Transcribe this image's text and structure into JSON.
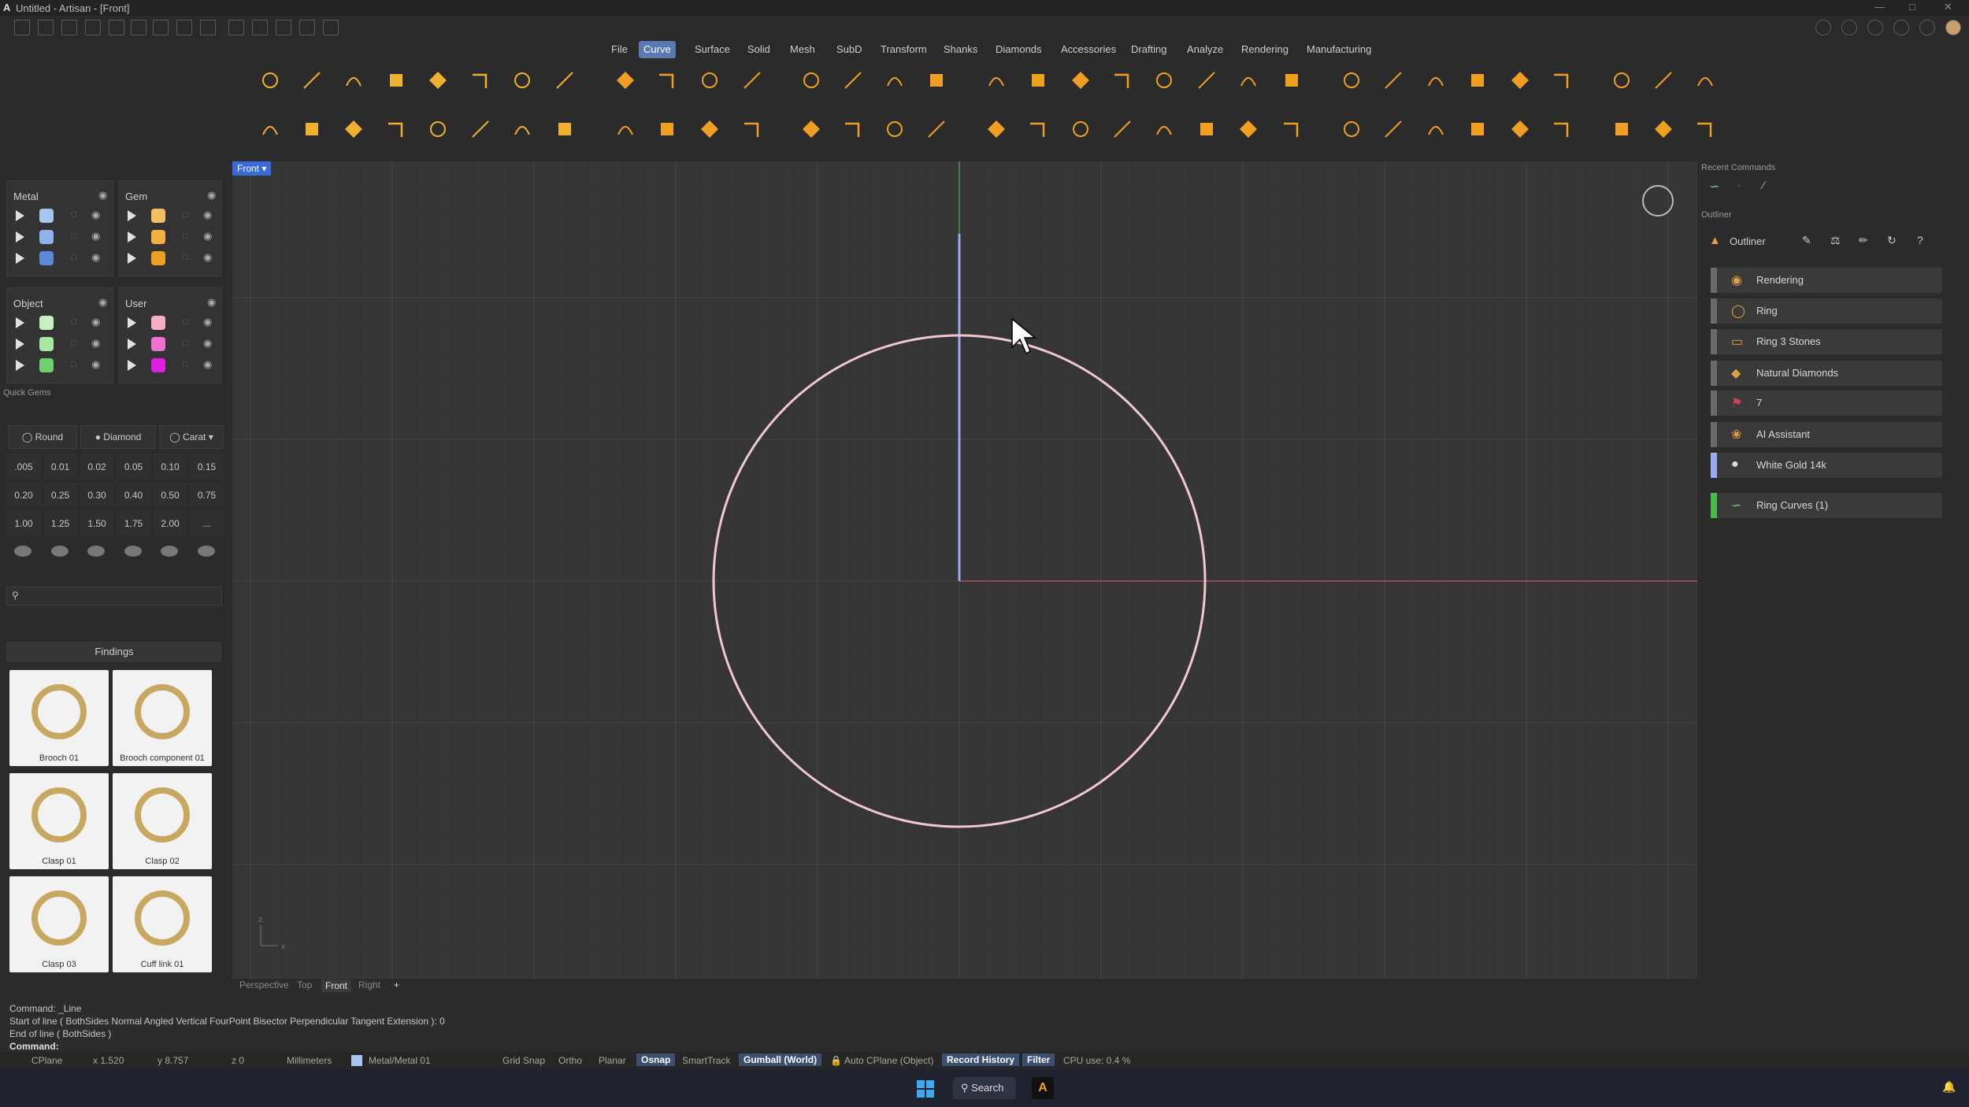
{
  "window": {
    "title": "Untitled - Artisan - [Front]"
  },
  "menu": {
    "tabs": [
      "File",
      "Curve",
      "Surface",
      "Solid",
      "Mesh",
      "SubD",
      "Transform",
      "Shanks",
      "Diamonds",
      "Accessories",
      "Drafting",
      "Analyze",
      "Rendering",
      "Manufacturing"
    ],
    "active": "Curve"
  },
  "layers": {
    "metal": {
      "title": "Metal",
      "colors": [
        "#a8c4f0",
        "#8fb2ea",
        "#5d88d8"
      ]
    },
    "gem": {
      "title": "Gem",
      "colors": [
        "#f5c060",
        "#f3b040",
        "#f0a020"
      ]
    },
    "object": {
      "title": "Object",
      "colors": [
        "#c8f0c0",
        "#a8e8a0",
        "#70d070"
      ]
    },
    "user": {
      "title": "User",
      "colors": [
        "#f5b0c8",
        "#f070d0",
        "#e020e0"
      ]
    }
  },
  "quick_gems": {
    "title": "Quick Gems",
    "shape": "Round",
    "material": "Diamond",
    "unit": "Carat",
    "sizes": [
      ".005",
      "0.01",
      "0.02",
      "0.05",
      "0.10",
      "0.15",
      "0.20",
      "0.25",
      "0.30",
      "0.40",
      "0.50",
      "0.75",
      "1.00",
      "1.25",
      "1.50",
      "1.75",
      "2.00",
      "..."
    ]
  },
  "library": {
    "category": "Findings",
    "items": [
      "Brooch 01",
      "Brooch component 01",
      "Clasp 01",
      "Clasp 02",
      "Clasp 03",
      "Cuff link 01"
    ]
  },
  "viewport": {
    "active_label": "Front",
    "tabs": [
      "Perspective",
      "Top",
      "Front",
      "Right",
      "+"
    ],
    "axis_x": "x",
    "axis_z": "z"
  },
  "right_panel": {
    "recent_commands_title": "Recent Commands",
    "outliner_title": "Outliner",
    "outliner_label": "Outliner",
    "items": [
      {
        "label": "Rendering",
        "icon": "palette-icon"
      },
      {
        "label": "Ring",
        "icon": "ring-icon"
      },
      {
        "label": "Ring 3 Stones",
        "icon": "ring-stones-icon"
      },
      {
        "label": "Natural Diamonds",
        "icon": "diamond-icon"
      },
      {
        "label": "7",
        "icon": "us-flag-icon"
      },
      {
        "label": "AI Assistant",
        "icon": "ai-icon"
      },
      {
        "label": "White Gold 14k",
        "icon": "material-ball-icon"
      },
      {
        "label": "Ring Curves (1)",
        "icon": "curve-icon"
      }
    ]
  },
  "command": {
    "lines": [
      "Command: _Line",
      "Start of line ( BothSides  Normal  Angled  Vertical  FourPoint  Bisector  Perpendicular  Tangent  Extension ): 0",
      "End of line ( BothSides )"
    ],
    "prompt": "Command:"
  },
  "status": {
    "cplane": "CPlane",
    "x": "x 1.520",
    "y": "y 8.757",
    "z": "z 0",
    "units": "Millimeters",
    "layer": "Metal/Metal 01",
    "grid_snap": "Grid Snap",
    "ortho": "Ortho",
    "planar": "Planar",
    "osnap": "Osnap",
    "smarttrack": "SmartTrack",
    "gumball": "Gumball (World)",
    "auto_cplane": "Auto CPlane (Object)",
    "record_history": "Record History",
    "filter": "Filter",
    "cpu": "CPU use: 0.4 %"
  },
  "taskbar": {
    "search": "Search"
  },
  "colors": {
    "accent": "#5a79b0",
    "tool_orange": "#f0a020",
    "circle": "#f0c8d0",
    "axis_red": "#b05060",
    "axis_green": "#4a9a4a",
    "axis_blue": "#9aaaf0"
  }
}
